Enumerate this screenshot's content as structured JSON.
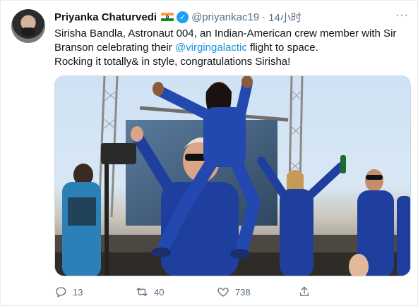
{
  "tweet": {
    "display_name": "Priyanka Chaturvedi",
    "handle": "@priyankac19",
    "separator": "·",
    "time": "14小时",
    "more": "···",
    "text_line1": "Sirisha Bandla, Astronaut 004, an Indian-American crew member with Sir",
    "text_line2_before": "Branson celebrating their ",
    "mention": "@virgingalactic",
    "text_line2_after": " flight to space.",
    "text_line3": "Rocking it totally& in style, congratulations Sirisha!",
    "media_alt": "Astronauts in blue flight suits celebrating; Sirisha Bandla on Richard Branson's shoulders"
  },
  "actions": {
    "reply_count": "13",
    "retweet_count": "40",
    "like_count": "738"
  },
  "icons": {
    "reply": "reply-icon",
    "retweet": "retweet-icon",
    "like": "heart-icon",
    "share": "share-icon",
    "verified": "verified-icon",
    "flag": "india-flag-icon"
  },
  "colors": {
    "link": "#1b95e0",
    "verified": "#1da1f2",
    "muted": "#5b7083",
    "suit": "#1e3f9e"
  }
}
